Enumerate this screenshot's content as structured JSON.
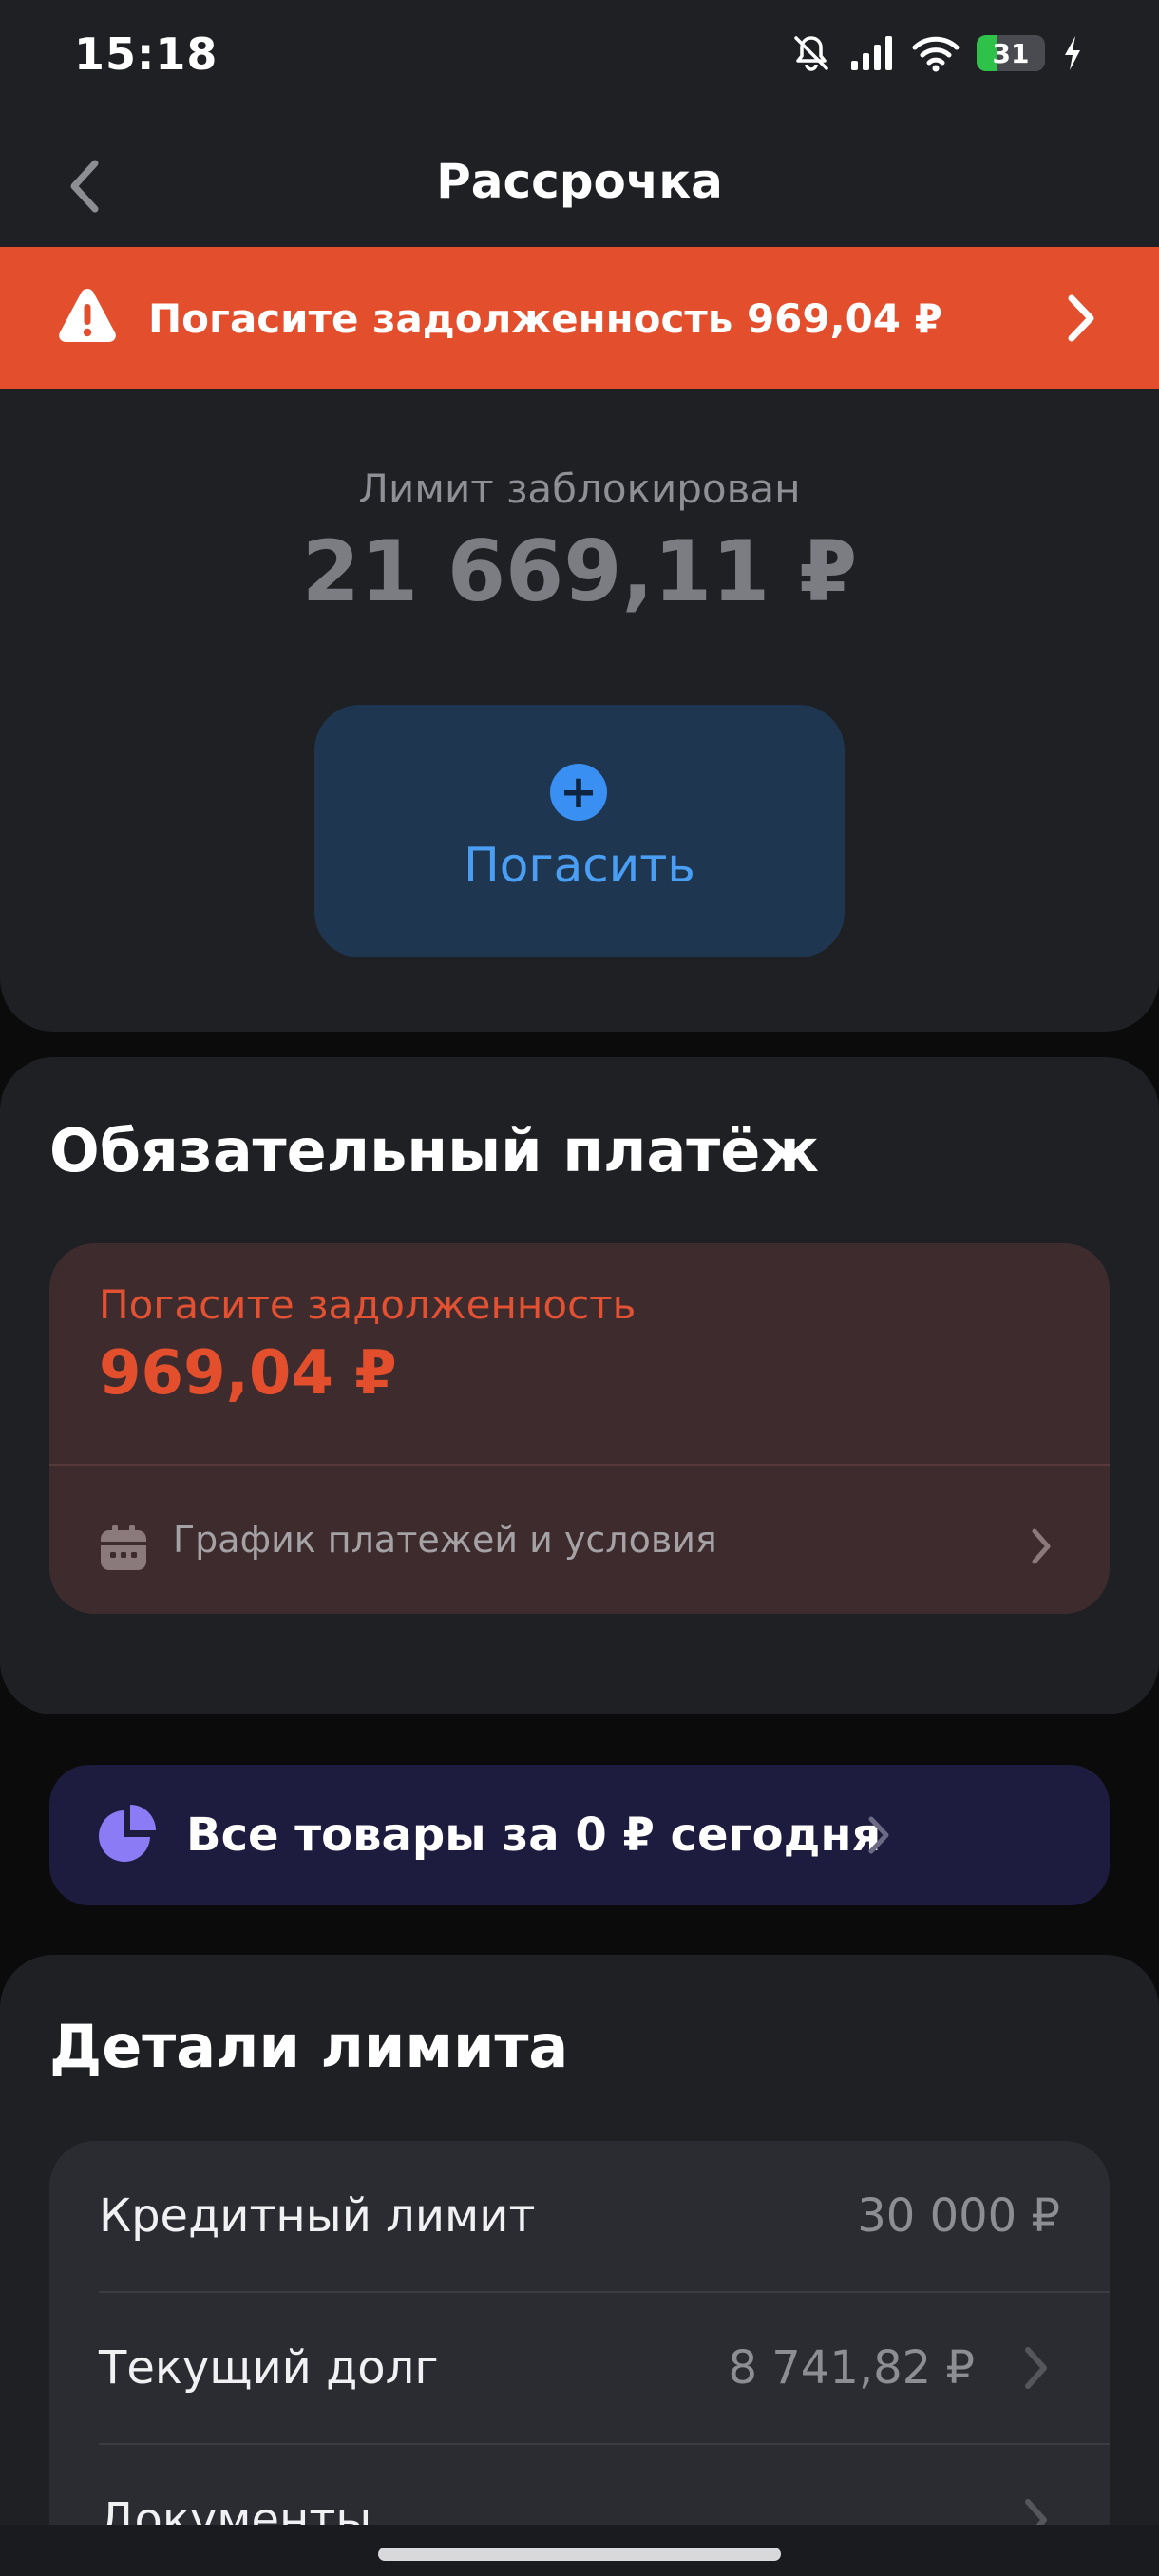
{
  "status_bar": {
    "time": "15:18",
    "battery_level": "31",
    "icons": [
      "bell-muted-icon",
      "signal-icon",
      "wifi-icon",
      "battery-icon",
      "charging-icon"
    ]
  },
  "header": {
    "title": "Рассрочка",
    "back_icon": "chevron-left-icon"
  },
  "warning_banner": {
    "text": "Погасите задолженность 969,04 ₽",
    "icon": "warning-icon",
    "color": "#e34f2d"
  },
  "limit": {
    "label": "Лимит заблокирован",
    "amount": "21 669,11 ₽"
  },
  "repay_button": {
    "label": "Погасить",
    "icon": "plus-icon"
  },
  "mandatory_payment": {
    "title": "Обязательный платёж",
    "caption": "Погасите задолженность",
    "amount": "969,04 ₽",
    "schedule_label": "График платежей и условия"
  },
  "promo": {
    "text": "Все товары за 0 ₽ сегодня",
    "icon": "pie-chart-icon"
  },
  "limit_details": {
    "title": "Детали лимита",
    "rows": [
      {
        "label": "Кредитный лимит",
        "value": "30 000 ₽"
      },
      {
        "label": "Текущий долг",
        "value": "8 741,82 ₽"
      },
      {
        "label": "Документы",
        "value": ""
      }
    ]
  },
  "colors": {
    "background": "#1f2024",
    "accent_blue": "#3a8ff3",
    "alert_red": "#e34f2d",
    "promo_purple": "#8b7cf6"
  }
}
